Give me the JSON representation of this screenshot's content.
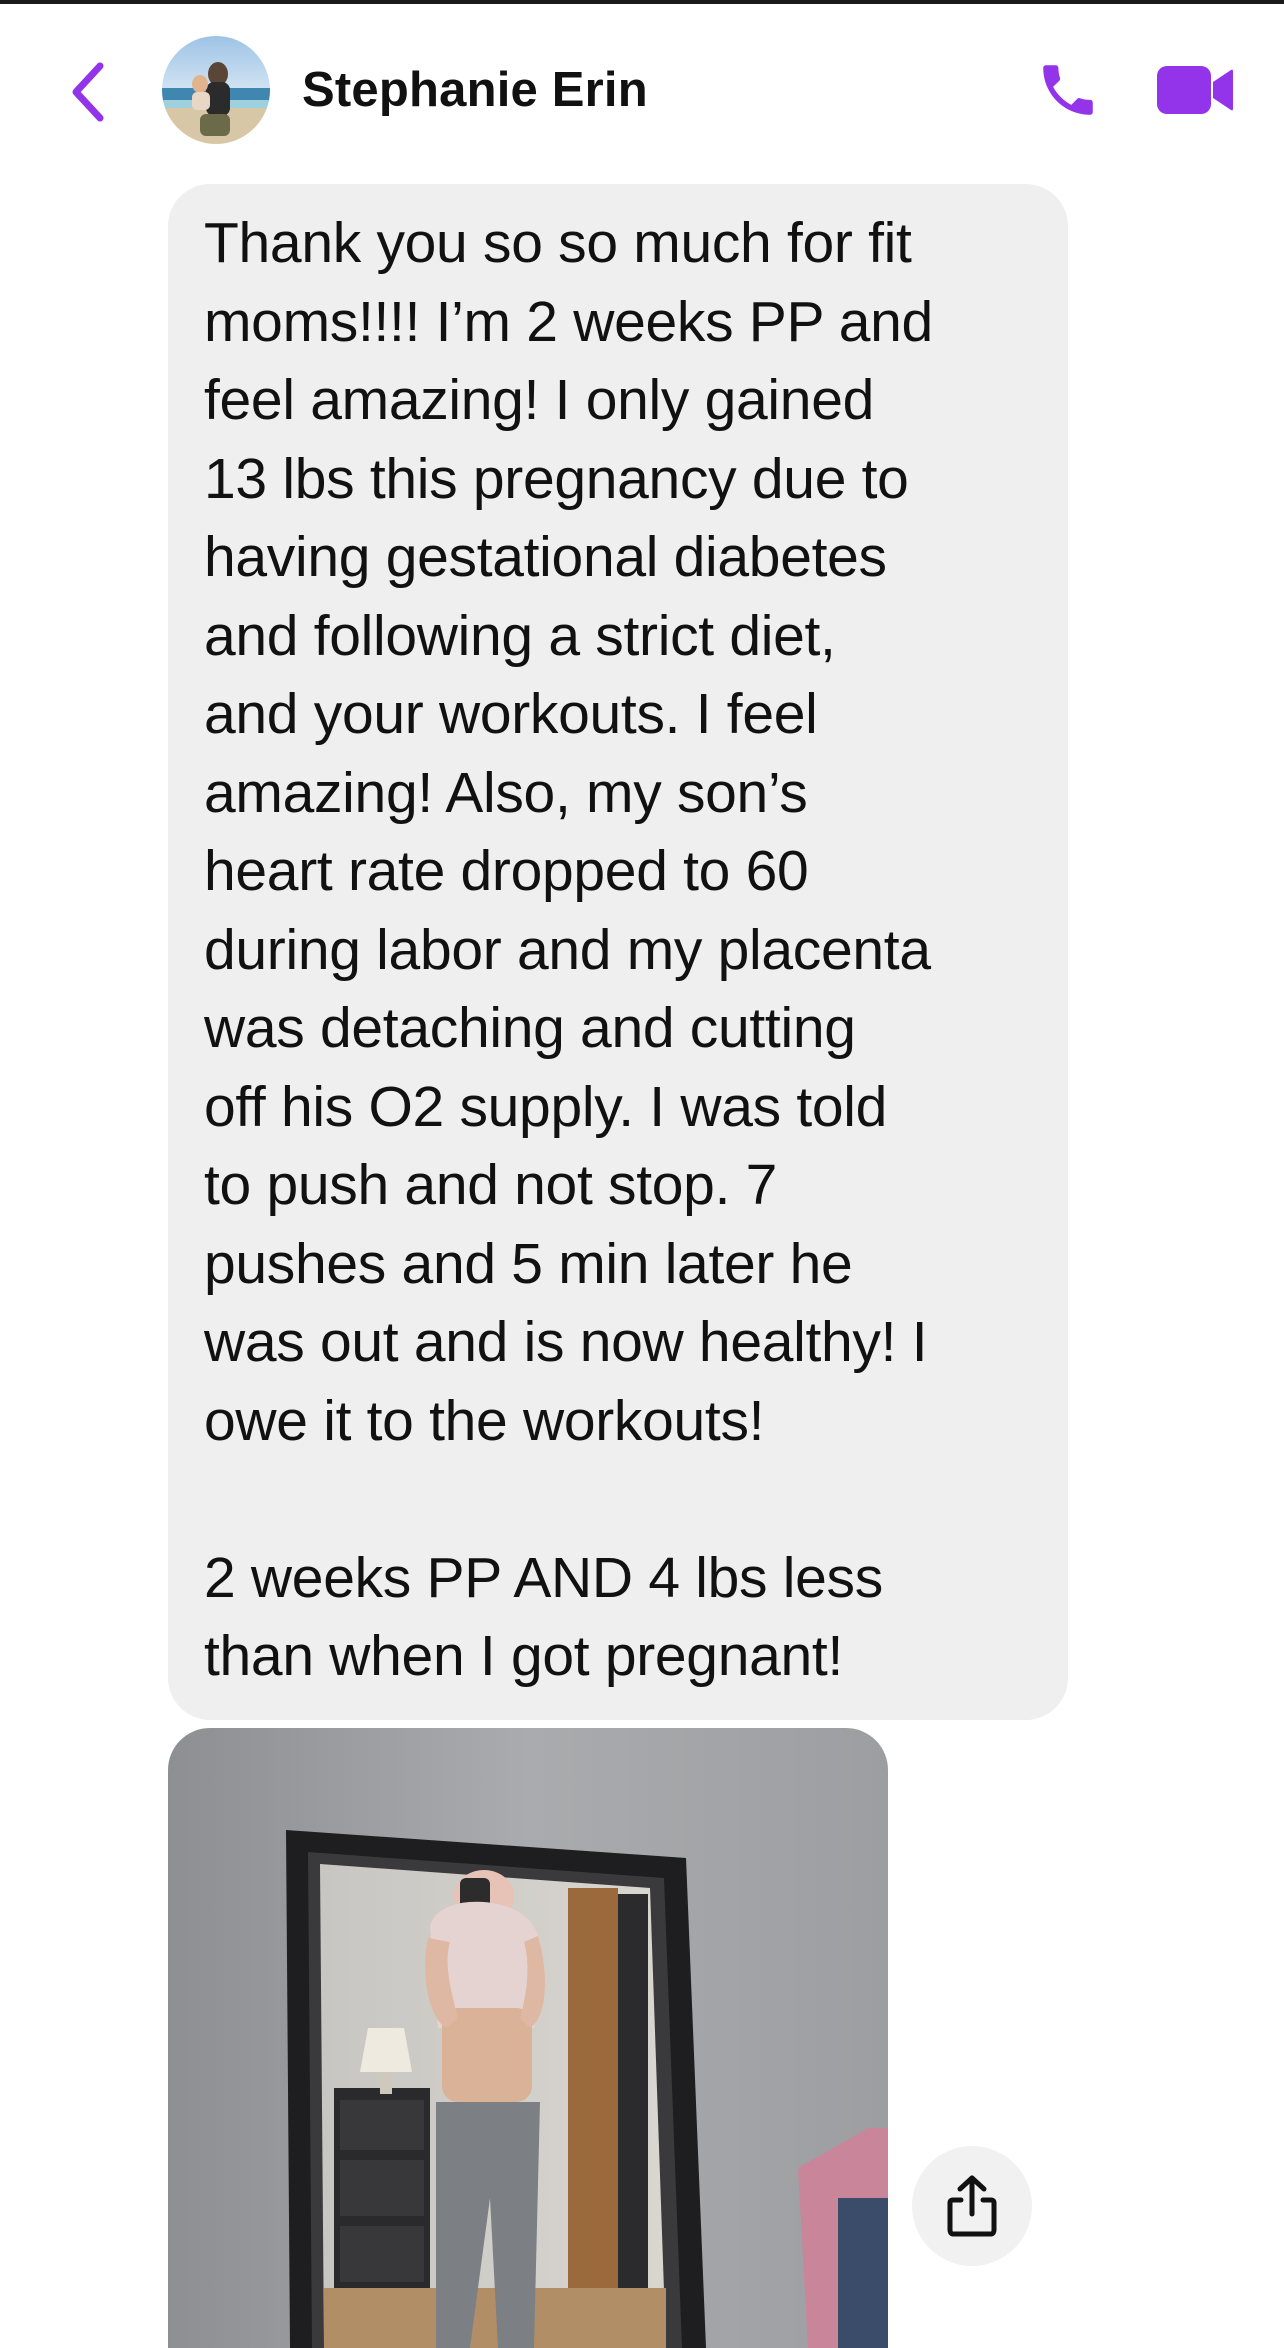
{
  "header": {
    "contact_name": "Stephanie Erin",
    "back_icon": "chevron-left-icon",
    "call_icon": "phone-icon",
    "video_icon": "video-camera-icon",
    "accent_color": "#9333ea"
  },
  "message": {
    "lines_part1": [
      "Thank you so so much for fit",
      "moms!!!! I’m 2 weeks PP and",
      "feel amazing! I only gained",
      "13 lbs this pregnancy due to",
      "having gestational diabetes",
      "and following a strict diet,",
      "and your workouts. I feel",
      "amazing! Also, my son’s",
      "heart rate dropped to 60",
      "during labor and my placenta",
      "was detaching and cutting",
      "off his O2 supply. I was told",
      "to push and not stop. 7",
      "pushes and 5 min later he",
      "was out and is now healthy! I",
      "owe it to the workouts!"
    ],
    "lines_part2": [
      "2 weeks PP AND 4 lbs less",
      "than when I got pregnant!"
    ],
    "bubble_color": "#efeff0"
  },
  "attachment": {
    "type": "photo",
    "share_icon": "share-icon"
  }
}
